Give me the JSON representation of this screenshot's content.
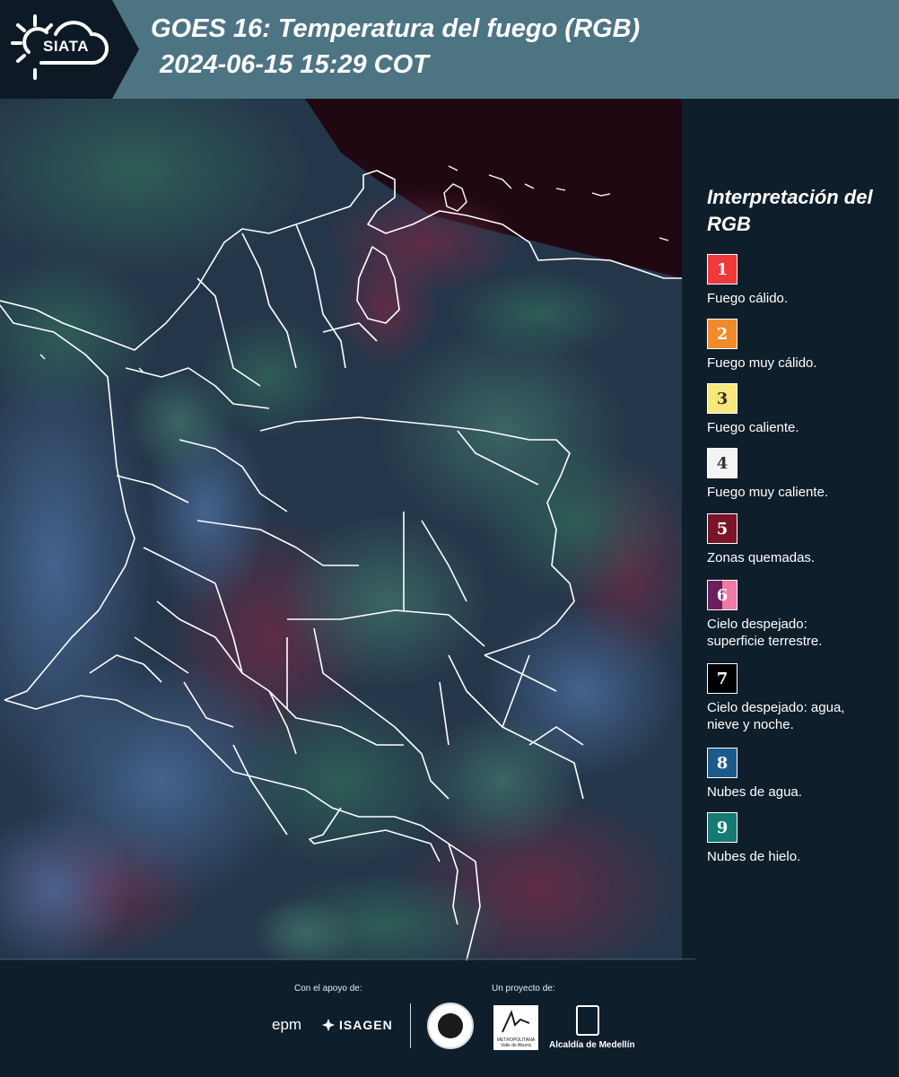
{
  "header": {
    "logo_text": "SIATA",
    "title": "GOES 16: Temperatura del fuego (RGB)",
    "timestamp": "2024-06-15 15:29 COT"
  },
  "legend": {
    "title": "Interpretación del RGB",
    "items": [
      {
        "number": "1",
        "label": "Fuego cálido.",
        "color": "#f0393a",
        "text_color": "#ffffff"
      },
      {
        "number": "2",
        "label": "Fuego muy cálido.",
        "color": "#f08a2a",
        "text_color": "#ffffff"
      },
      {
        "number": "3",
        "label": "Fuego caliente.",
        "color": "#f6e87a",
        "text_color": "#333333"
      },
      {
        "number": "4",
        "label": "Fuego muy caliente.",
        "color": "#f4f4f4",
        "text_color": "#333333"
      },
      {
        "number": "5",
        "label": "Zonas quemadas.",
        "color": "#7a1428",
        "text_color": "#ffffff"
      },
      {
        "number": "6",
        "label": "Cielo despejado: superficie terrestre.",
        "color": "#6a1f5e",
        "color2": "#f07aa6",
        "text_color": "#ffffff"
      },
      {
        "number": "7",
        "label": "Cielo despejado: agua, nieve y noche.",
        "color": "#000000",
        "text_color": "#ffffff"
      },
      {
        "number": "8",
        "label": "Nubes de agua.",
        "color": "#1c5a8c",
        "text_color": "#ffffff"
      },
      {
        "number": "9",
        "label": "Nubes de hielo.",
        "color": "#147a72",
        "text_color": "#ffffff"
      }
    ]
  },
  "footer": {
    "support_caption": "Con el apoyo de:",
    "project_caption": "Un proyecto de:",
    "sponsor_epm": "epm",
    "sponsor_isagen": "ISAGEN",
    "area_logo_text": "METROPOLITANA Valle de Aburrá",
    "alcaldia_text": "Alcaldía de Medellín"
  }
}
